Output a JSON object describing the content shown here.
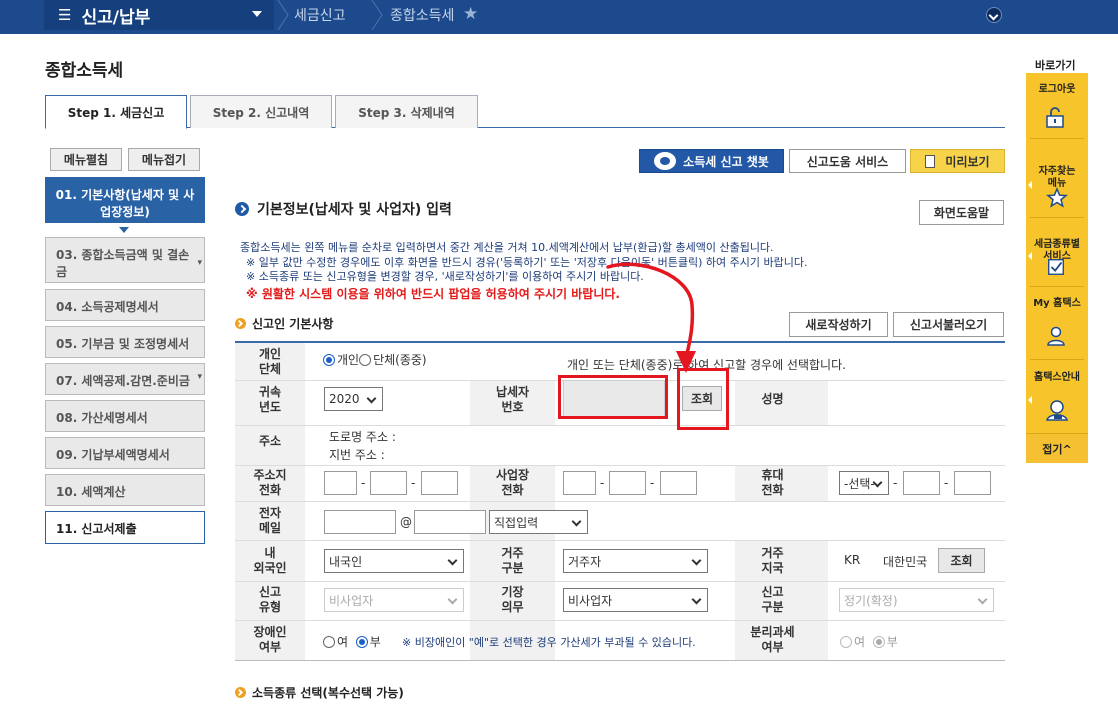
{
  "topbar": {
    "menu": "신고/납부",
    "crumbs": [
      "세금신고",
      "종합소득세"
    ]
  },
  "page_title": "종합소득세",
  "steps": [
    "Step 1. 세금신고",
    "Step 2. 신고내역",
    "Step 3. 삭제내역"
  ],
  "nav": {
    "expand": "메뉴펼침",
    "collapse": "메뉴접기",
    "items": [
      "01. 기본사항(납세자 및 사업장정보)",
      "03. 종합소득금액 및 결손금",
      "04. 소득공제명세서",
      "05. 기부금 및 조정명세서",
      "07. 세액공제.감면.준비금",
      "08. 가산세명세서",
      "09. 기납부세액명세서",
      "10. 세액계산",
      "11. 신고서제출"
    ]
  },
  "header_buttons": {
    "chatbot": "소득세 신고 챗봇",
    "help_service": "신고도움 서비스",
    "preview": "미리보기",
    "screen_help": "화면도움말",
    "new_write": "새로작성하기",
    "load": "신고서불러오기"
  },
  "section_title": "기본정보(납세자 및 사업자) 입력",
  "info": [
    "종합소득세는 왼쪽 메뉴를 순차로 입력하면서 중간 계산을 거쳐 10.세액계산에서 납부(환급)할 총세액이 산출됩니다.",
    "※ 일부 값만 수정한 경우에도 이후 화면을 반드시 경유('등록하기' 또는 '저장후 다음이동' 버튼클릭) 하여 주시기 바랍니다.",
    "※ 소득종류 또는 신고유형을 변경할 경우, '새로작성하기'를 이용하여 주시기 바랍니다.",
    "※ 원활한 시스템 이용을 위하여 반드시 팝업을 허용하여 주시기 바랍니다."
  ],
  "sub_title": "신고인 기본사항",
  "form": {
    "type_label": "개인\n단체",
    "type_opt1": "개인",
    "type_opt2": "단체(종중)",
    "type_note": "개인 또는 단체(종중)로 하여 신고할 경우에 선택합니다.",
    "year_label": "귀속\n년도",
    "year_value": "2020",
    "taxpayer_label": "납세자\n번호",
    "lookup": "조회",
    "name_label": "성명",
    "addr_label": "주소",
    "road_addr": "도로명 주소 :",
    "lot_addr": "지번 주소 :",
    "home_tel_label": "주소지\n전화",
    "biz_tel_label": "사업장\n전화",
    "mobile_label": "휴대\n전화",
    "mobile_select": "-선택-",
    "email_label": "전자\n메일",
    "at": "@",
    "email_domain": "직접입력",
    "nation_label": "내\n외국인",
    "nation_value": "내국인",
    "resid_label": "거주\n구분",
    "resid_value": "거주자",
    "country_label": "거주\n지국",
    "country_code": "KR",
    "country_name": "대한민국",
    "report_type_label": "신고\n유형",
    "report_type_value": "비사업자",
    "book_label": "기장\n의무",
    "book_value": "비사업자",
    "report_div_label": "신고\n구분",
    "report_div_value": "정기(확정)",
    "disabled_label": "장애인\n여부",
    "yes": "여",
    "no": "부",
    "disabled_note": "※ 비장애인이 \"예\"로 선택한 경우 가산세가 부과될 수 있습니다.",
    "sep_tax_label": "분리과세\n여부"
  },
  "section2_title": "소득종류 선택(복수선택 가능)",
  "quick": {
    "title": "바로가기",
    "items": [
      "로그아웃",
      "자주찾는\n메뉴",
      "세금종류별\n서비스",
      "My 홈택스",
      "홈택스안내"
    ],
    "close": "접기^"
  }
}
